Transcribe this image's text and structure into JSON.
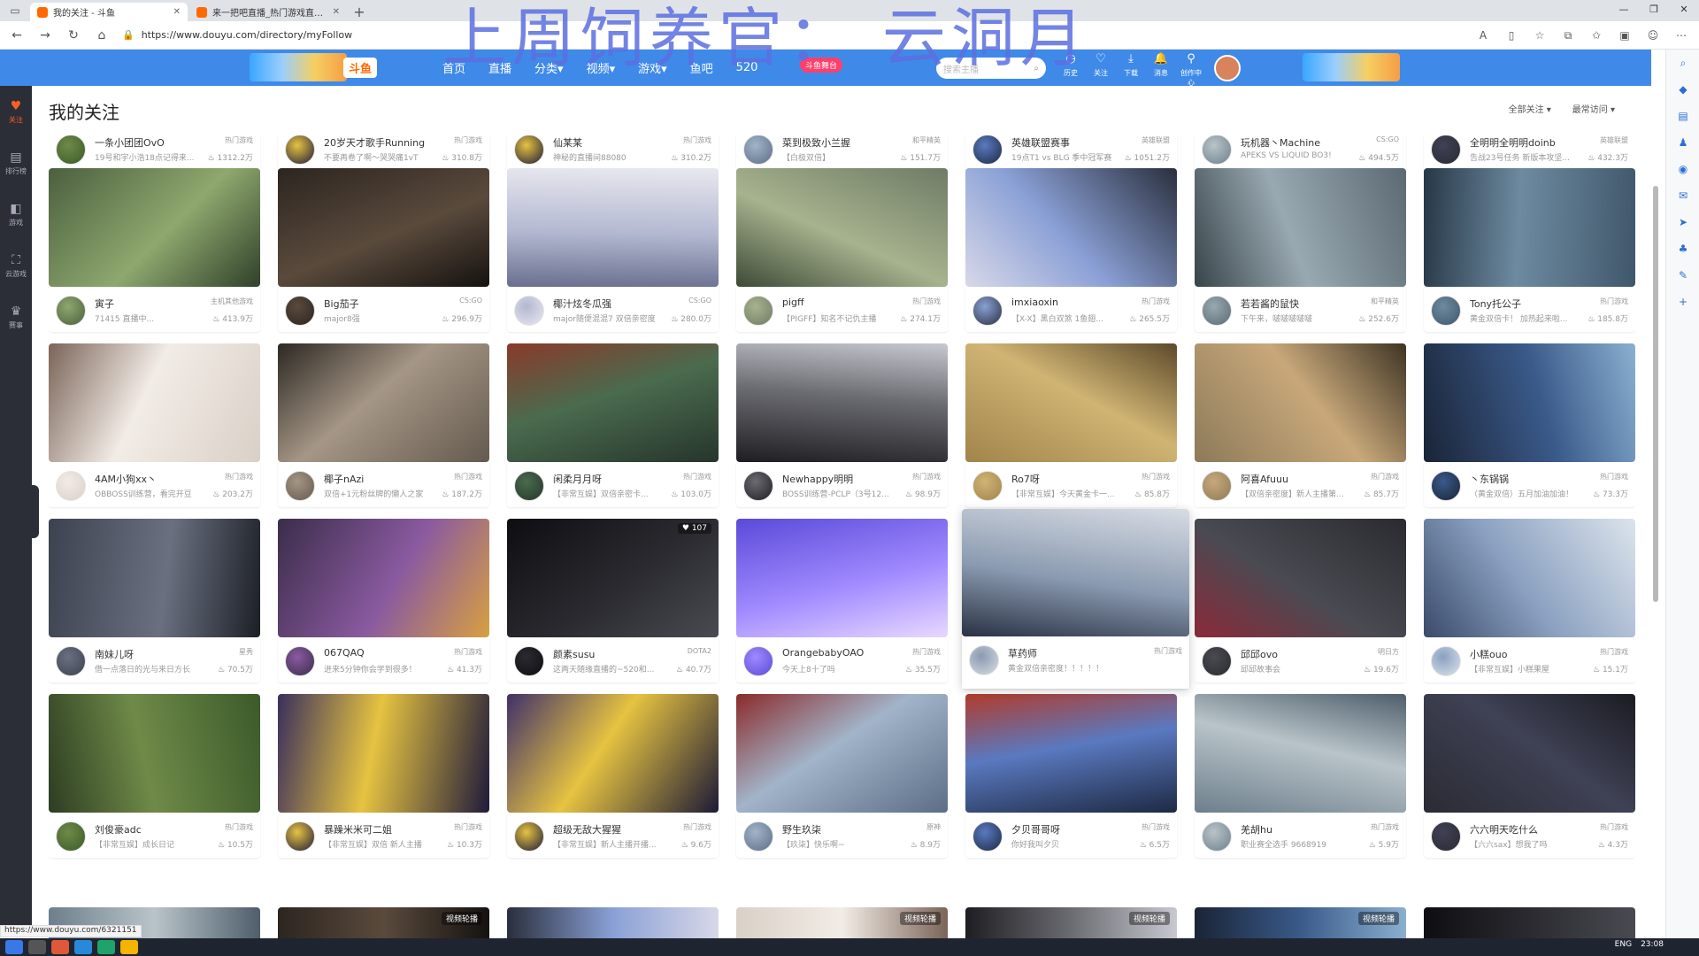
{
  "browser": {
    "tabs": [
      {
        "title": "我的关注 - 斗鱼",
        "active": true
      },
      {
        "title": "来一把吧直播_热门游戏直播_斗鱼",
        "active": false
      }
    ],
    "new_tab": "+",
    "url": "https://www.douyu.com/directory/myFollow",
    "status_url": "https://www.douyu.com/6321151"
  },
  "overlay_text": "上周饲养官： 云洞月",
  "header": {
    "logo": "斗鱼",
    "nav": [
      "首页",
      "直播",
      "分类▾",
      "视频▾",
      "游戏▾",
      "鱼吧",
      "520"
    ],
    "stage": "斗鱼舞台",
    "search_placeholder": "搜索主播",
    "icons": [
      {
        "label": "历史",
        "icon": "history-icon",
        "glyph": "◷"
      },
      {
        "label": "关注",
        "icon": "heart-icon",
        "glyph": "♡"
      },
      {
        "label": "下载",
        "icon": "download-icon",
        "glyph": "⤓"
      },
      {
        "label": "消息",
        "icon": "bell-icon",
        "glyph": "🔔"
      },
      {
        "label": "创作中心",
        "icon": "creator-icon",
        "glyph": "⚲"
      }
    ]
  },
  "left_nav": [
    {
      "label": "关注",
      "icon": "heart-icon",
      "glyph": "♥",
      "active": true
    },
    {
      "label": "排行榜",
      "icon": "rank-icon",
      "glyph": "▤",
      "active": false
    },
    {
      "label": "游戏",
      "icon": "game-icon",
      "glyph": "◧",
      "active": false
    },
    {
      "label": "云游戏",
      "icon": "cloud-game-icon",
      "glyph": "⛶",
      "active": false
    },
    {
      "label": "赛事",
      "icon": "trophy-icon",
      "glyph": "♛",
      "active": false
    }
  ],
  "page": {
    "title": "我的关注",
    "filters": [
      "全部关注 ▾",
      "最常访问 ▾"
    ]
  },
  "top_row": [
    {
      "name": "一条小团团OvO",
      "cat": "热门游戏",
      "desc": "19号和宇小浩18点记得来...",
      "hot": "1312.2万"
    },
    {
      "name": "20岁天才歌手Running",
      "cat": "热门游戏",
      "desc": "不要再卷了啊～哭哭痛1vT",
      "hot": "310.8万"
    },
    {
      "name": "仙某某",
      "cat": "热门游戏",
      "desc": "神秘的直播间88080",
      "hot": "310.2万"
    },
    {
      "name": "菜到极致小兰握",
      "cat": "和平精英",
      "desc": "【白极双倍】",
      "hot": "151.7万"
    },
    {
      "name": "英雄联盟赛事",
      "cat": "英雄联盟",
      "desc": "19点T1 vs BLG 季中冠军赛",
      "hot": "1051.2万"
    },
    {
      "name": "玩机器丶Machine",
      "cat": "CS:GO",
      "desc": "APEKS VS LIQUID BO3!",
      "hot": "494.5万"
    },
    {
      "name": "全明明全明明doinb",
      "cat": "英雄联盟",
      "desc": "告战23号任务 新版本攻坚...",
      "hot": "432.3万"
    }
  ],
  "rows": [
    [
      {
        "name": "寅子",
        "cat": "主机其他游戏",
        "desc": "71415 直播中...",
        "hot": "413.9万"
      },
      {
        "name": "Big茄子",
        "cat": "CS:GO",
        "desc": "major8强",
        "hot": "296.9万"
      },
      {
        "name": "椰汁炫冬瓜强",
        "cat": "CS:GO",
        "desc": "major随便混混7 双倍亲密度",
        "hot": "280.0万"
      },
      {
        "name": "pigff",
        "cat": "热门游戏",
        "desc": "【PIGFF】知名不记仇主播",
        "hot": "274.1万"
      },
      {
        "name": "imxiaoxin",
        "cat": "热门游戏",
        "desc": "【X-X】黑白双煞 1鱼翅...",
        "hot": "265.5万"
      },
      {
        "name": "若若酱的鼠快",
        "cat": "和平精英",
        "desc": "下午来，啵啵啵啵啵",
        "hot": "252.6万"
      },
      {
        "name": "Tony托公子",
        "cat": "热门游戏",
        "desc": "黄金双倍卡！ 加热起来啦...",
        "hot": "185.8万"
      }
    ],
    [
      {
        "name": "4AM小狗xx丶",
        "cat": "热门游戏",
        "desc": "OBBOSS训练营，看完开豆",
        "hot": "203.2万"
      },
      {
        "name": "椰子nAzi",
        "cat": "热门游戏",
        "desc": "双倍+1元粉丝牌的懒人之家",
        "hot": "187.2万"
      },
      {
        "name": "闲柔月月呀",
        "cat": "热门游戏",
        "desc": "【非常互娱】双倍亲密卡...",
        "hot": "103.0万"
      },
      {
        "name": "Newhappy明明",
        "cat": "热门游戏",
        "desc": "BOSS训练营-PCLP（3号12...",
        "hot": "98.9万"
      },
      {
        "name": "Ro7呀",
        "cat": "热门游戏",
        "desc": "【非常互娱】今天黄金卡一...",
        "hot": "85.8万"
      },
      {
        "name": "阿喜Afuuu",
        "cat": "热门游戏",
        "desc": "【双倍亲密度】新人主播第...",
        "hot": "85.7万"
      },
      {
        "name": "丶东锅锅",
        "cat": "热门游戏",
        "desc": "（黄金双倍）五月加油加油！",
        "hot": "73.3万"
      }
    ],
    [
      {
        "name": "南妹儿呀",
        "cat": "星秀",
        "desc": "借一点落日的光与来日方长",
        "hot": "70.5万"
      },
      {
        "name": "067QAQ",
        "cat": "热门游戏",
        "desc": "进来5分钟你会学到很多！",
        "hot": "41.3万"
      },
      {
        "name": "颜素susu",
        "cat": "DOTA2",
        "desc": "这两天随缘直播的~520和...",
        "hot": "40.7万"
      },
      {
        "name": "OrangebabyOAO",
        "cat": "热门游戏",
        "desc": "今天上8十了吗",
        "hot": "35.5万"
      },
      {
        "name": "草药师",
        "cat": "热门游戏",
        "desc": "黄金双倍亲密度！！！！！",
        "hot": "",
        "hover": true
      },
      {
        "name": "邱邱ovo",
        "cat": "明日方",
        "desc": "邱邱故事会",
        "hot": "19.6万"
      },
      {
        "name": "小糕ouo",
        "cat": "热门游戏",
        "desc": "【非常互娱】小糕果屋",
        "hot": "15.1万"
      }
    ],
    [
      {
        "name": "刘俊豪adc",
        "cat": "热门游戏",
        "desc": "【非常互娱】成长日记",
        "hot": "10.5万"
      },
      {
        "name": "暴躁米米可二姐",
        "cat": "热门游戏",
        "desc": "【非常互娱】双倍 新人主播",
        "hot": "10.3万"
      },
      {
        "name": "超级无敌大猩猩",
        "cat": "热门游戏",
        "desc": "【非常互娱】新人主播开播...",
        "hot": "9.6万"
      },
      {
        "name": "野生玖柒",
        "cat": "原神",
        "desc": "【玖柒】快乐啊~",
        "hot": "8.9万"
      },
      {
        "name": "夕贝哥哥呀",
        "cat": "热门游戏",
        "desc": "你好我叫夕贝",
        "hot": "6.5万"
      },
      {
        "name": "羌胡hu",
        "cat": "热门游戏",
        "desc": "职业赛全选手 9668919",
        "hot": "5.9万"
      },
      {
        "name": "六六明天吃什么",
        "cat": "热门游戏",
        "desc": "【六六sax】想我了吗",
        "hot": "4.3万"
      }
    ]
  ],
  "overlay_tags": {
    "likes": "♥ 107",
    "replay": "视频轮播"
  },
  "colors": {
    "header_blue": "#3f8ae9",
    "douyu_orange": "#ff6a00",
    "sidebar_dark": "#2b2e36"
  },
  "taskbar": {
    "lang": "ENG",
    "time": "23:08"
  }
}
